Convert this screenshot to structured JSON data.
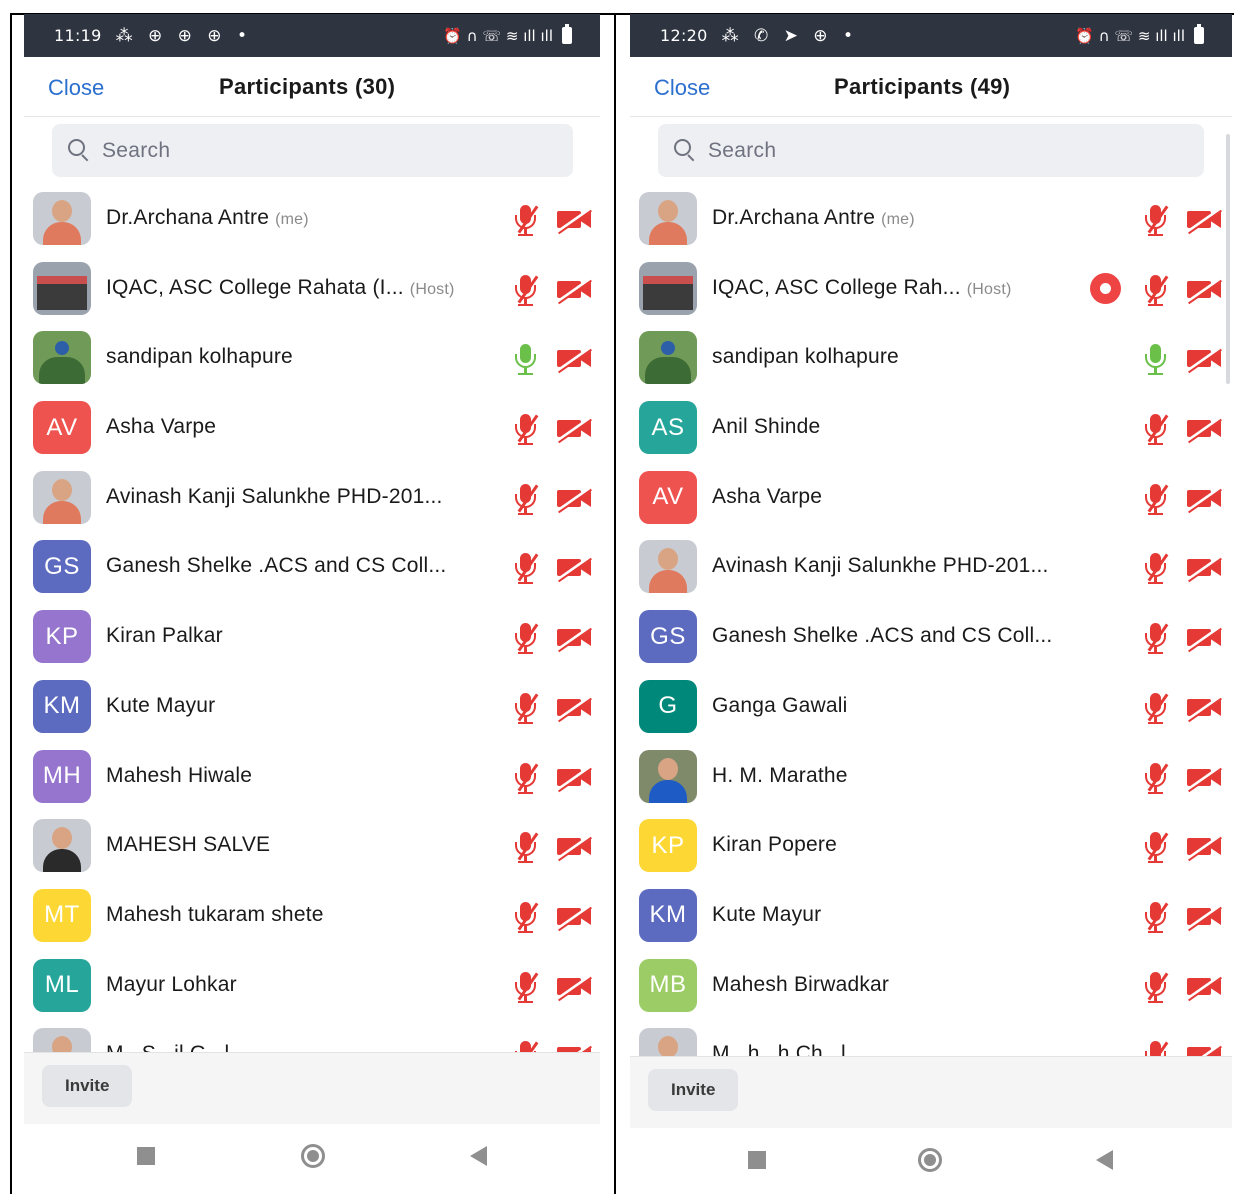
{
  "left": {
    "status": {
      "time": "11:19",
      "notif_icons": "⁂ ⊕ ⊕ ⊕ •",
      "sys_icons": "⏰ ∩ ☏ ≋ ıll ıll"
    },
    "header": {
      "close_label": "Close",
      "title": "Participants (30)"
    },
    "search": {
      "placeholder": "Search"
    },
    "participants": [
      {
        "name": "Dr.Archana Antre",
        "tag": "(me)",
        "avatar": {
          "type": "photo",
          "style": "woman"
        },
        "mic": "muted",
        "video": "off"
      },
      {
        "name": "IQAC, ASC College Rahata (I...",
        "tag": "(Host)",
        "avatar": {
          "type": "photo",
          "style": "building"
        },
        "mic": "muted",
        "video": "off"
      },
      {
        "name": "sandipan kolhapure",
        "tag": "",
        "avatar": {
          "type": "photo",
          "style": "peacock"
        },
        "mic": "live",
        "video": "off"
      },
      {
        "name": "Asha Varpe",
        "tag": "",
        "avatar": {
          "type": "initials",
          "initials": "AV",
          "color": "#ef5350"
        },
        "mic": "muted",
        "video": "off"
      },
      {
        "name": "Avinash Kanji Salunkhe PHD-201...",
        "tag": "",
        "avatar": {
          "type": "photo",
          "style": "man"
        },
        "mic": "muted",
        "video": "off"
      },
      {
        "name": "Ganesh Shelke .ACS and CS Coll...",
        "tag": "",
        "avatar": {
          "type": "initials",
          "initials": "GS",
          "color": "#5c6bc0"
        },
        "mic": "muted",
        "video": "off"
      },
      {
        "name": "Kiran Palkar",
        "tag": "",
        "avatar": {
          "type": "initials",
          "initials": "KP",
          "color": "#9575cd"
        },
        "mic": "muted",
        "video": "off"
      },
      {
        "name": "Kute Mayur",
        "tag": "",
        "avatar": {
          "type": "initials",
          "initials": "KM",
          "color": "#5c6bc0"
        },
        "mic": "muted",
        "video": "off"
      },
      {
        "name": "Mahesh Hiwale",
        "tag": "",
        "avatar": {
          "type": "initials",
          "initials": "MH",
          "color": "#9575cd"
        },
        "mic": "muted",
        "video": "off"
      },
      {
        "name": "MAHESH SALVE",
        "tag": "",
        "avatar": {
          "type": "photo",
          "style": "suit"
        },
        "mic": "muted",
        "video": "off"
      },
      {
        "name": "Mahesh tukaram shete",
        "tag": "",
        "avatar": {
          "type": "initials",
          "initials": "MT",
          "color": "#fdd835"
        },
        "mic": "muted",
        "video": "off"
      },
      {
        "name": "Mayur Lohkar",
        "tag": "",
        "avatar": {
          "type": "initials",
          "initials": "ML",
          "color": "#26a69a"
        },
        "mic": "muted",
        "video": "off"
      },
      {
        "name": "M...S...il G...l",
        "tag": "",
        "avatar": {
          "type": "photo",
          "style": "man"
        },
        "mic": "muted",
        "video": "off"
      }
    ],
    "invite_label": "Invite"
  },
  "right": {
    "status": {
      "time": "12:20",
      "notif_icons": "⁂ ✆ ➤ ⊕ •",
      "sys_icons": "⏰ ∩ ☏ ≋ ıll ıll"
    },
    "header": {
      "close_label": "Close",
      "title": "Participants (49)"
    },
    "search": {
      "placeholder": "Search"
    },
    "participants": [
      {
        "name": "Dr.Archana Antre",
        "tag": "(me)",
        "avatar": {
          "type": "photo",
          "style": "woman"
        },
        "mic": "muted",
        "video": "off",
        "recording": false
      },
      {
        "name": "IQAC, ASC College Rah...",
        "tag": "(Host)",
        "avatar": {
          "type": "photo",
          "style": "building"
        },
        "mic": "muted",
        "video": "off",
        "recording": true
      },
      {
        "name": "sandipan kolhapure",
        "tag": "",
        "avatar": {
          "type": "photo",
          "style": "peacock"
        },
        "mic": "live",
        "video": "off",
        "recording": false
      },
      {
        "name": "Anil Shinde",
        "tag": "",
        "avatar": {
          "type": "initials",
          "initials": "AS",
          "color": "#26a69a"
        },
        "mic": "muted",
        "video": "off",
        "recording": false
      },
      {
        "name": "Asha Varpe",
        "tag": "",
        "avatar": {
          "type": "initials",
          "initials": "AV",
          "color": "#ef5350"
        },
        "mic": "muted",
        "video": "off",
        "recording": false
      },
      {
        "name": "Avinash Kanji Salunkhe PHD-201...",
        "tag": "",
        "avatar": {
          "type": "photo",
          "style": "man"
        },
        "mic": "muted",
        "video": "off",
        "recording": false
      },
      {
        "name": "Ganesh Shelke .ACS and CS Coll...",
        "tag": "",
        "avatar": {
          "type": "initials",
          "initials": "GS",
          "color": "#5c6bc0"
        },
        "mic": "muted",
        "video": "off",
        "recording": false
      },
      {
        "name": "Ganga Gawali",
        "tag": "",
        "avatar": {
          "type": "initials",
          "initials": "G",
          "color": "#00897b"
        },
        "mic": "muted",
        "video": "off",
        "recording": false
      },
      {
        "name": "H. M. Marathe",
        "tag": "",
        "avatar": {
          "type": "photo",
          "style": "blue"
        },
        "mic": "muted",
        "video": "off",
        "recording": false
      },
      {
        "name": "Kiran Popere",
        "tag": "",
        "avatar": {
          "type": "initials",
          "initials": "KP",
          "color": "#fdd835"
        },
        "mic": "muted",
        "video": "off",
        "recording": false
      },
      {
        "name": "Kute Mayur",
        "tag": "",
        "avatar": {
          "type": "initials",
          "initials": "KM",
          "color": "#5c6bc0"
        },
        "mic": "muted",
        "video": "off",
        "recording": false
      },
      {
        "name": "Mahesh Birwadkar",
        "tag": "",
        "avatar": {
          "type": "initials",
          "initials": "MB",
          "color": "#9ccc65"
        },
        "mic": "muted",
        "video": "off",
        "recording": false
      },
      {
        "name": "M...h...h Ch...l",
        "tag": "",
        "avatar": {
          "type": "photo",
          "style": "man"
        },
        "mic": "muted",
        "video": "off",
        "recording": false
      }
    ],
    "invite_label": "Invite"
  }
}
